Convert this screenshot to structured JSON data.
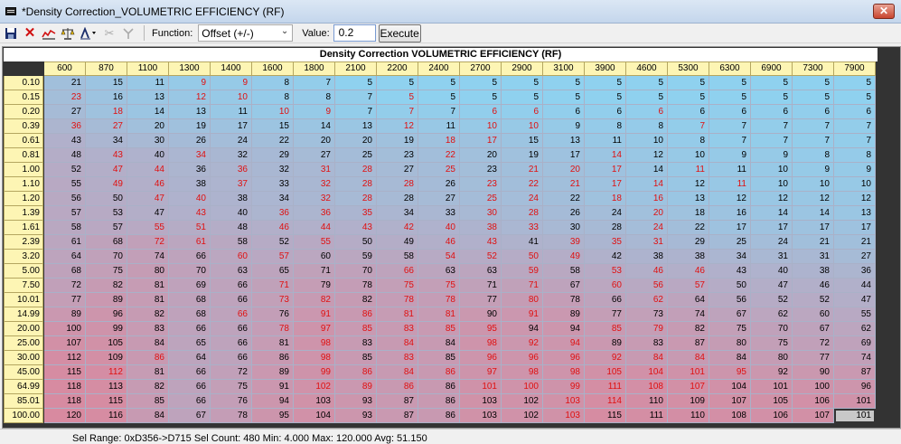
{
  "window": {
    "title": "*Density Correction_VOLUMETRIC EFFICIENCY (RF)",
    "close_label": "✕"
  },
  "toolbar": {
    "function_label": "Function:",
    "function_value": "Offset (+/-)",
    "value_label": "Value:",
    "value": "0.2",
    "execute_label": "Execute"
  },
  "table": {
    "title": "Density Correction  VOLUMETRIC EFFICIENCY (RF)",
    "columns": [
      "600",
      "870",
      "1100",
      "1300",
      "1400",
      "1600",
      "1800",
      "2100",
      "2200",
      "2400",
      "2700",
      "2900",
      "3100",
      "3900",
      "4600",
      "5300",
      "6300",
      "6900",
      "7300",
      "7900"
    ],
    "rows": [
      "0.10",
      "0.15",
      "0.20",
      "0.39",
      "0.61",
      "0.81",
      "1.00",
      "1.10",
      "1.20",
      "1.39",
      "1.61",
      "2.39",
      "3.20",
      "5.00",
      "7.50",
      "10.01",
      "14.99",
      "20.00",
      "25.00",
      "30.00",
      "45.00",
      "64.99",
      "85.01",
      "100.00"
    ],
    "values": [
      [
        21,
        15,
        11,
        9,
        9,
        8,
        7,
        5,
        5,
        5,
        5,
        5,
        5,
        5,
        5,
        5,
        5,
        5,
        5,
        5
      ],
      [
        23,
        16,
        13,
        12,
        10,
        8,
        8,
        7,
        5,
        5,
        5,
        5,
        5,
        5,
        5,
        5,
        5,
        5,
        5,
        5
      ],
      [
        27,
        18,
        14,
        13,
        11,
        10,
        9,
        7,
        7,
        7,
        6,
        6,
        6,
        6,
        6,
        6,
        6,
        6,
        6,
        6
      ],
      [
        36,
        27,
        20,
        19,
        17,
        15,
        14,
        13,
        12,
        11,
        10,
        10,
        9,
        8,
        8,
        7,
        7,
        7,
        7,
        7
      ],
      [
        43,
        34,
        30,
        26,
        24,
        22,
        20,
        20,
        19,
        18,
        17,
        15,
        13,
        11,
        10,
        8,
        7,
        7,
        7,
        7
      ],
      [
        48,
        43,
        40,
        34,
        32,
        29,
        27,
        25,
        23,
        22,
        20,
        19,
        17,
        14,
        12,
        10,
        9,
        9,
        8,
        8
      ],
      [
        52,
        47,
        44,
        36,
        36,
        32,
        31,
        28,
        27,
        25,
        23,
        21,
        20,
        17,
        14,
        11,
        11,
        10,
        9,
        9
      ],
      [
        55,
        49,
        46,
        38,
        37,
        33,
        32,
        28,
        28,
        26,
        23,
        22,
        21,
        17,
        14,
        12,
        11,
        10,
        10,
        10
      ],
      [
        56,
        50,
        47,
        40,
        38,
        34,
        32,
        28,
        28,
        27,
        25,
        24,
        22,
        18,
        16,
        13,
        12,
        12,
        12,
        12
      ],
      [
        57,
        53,
        47,
        43,
        40,
        36,
        36,
        35,
        34,
        33,
        30,
        28,
        26,
        24,
        20,
        18,
        16,
        14,
        14,
        13
      ],
      [
        58,
        57,
        55,
        51,
        48,
        46,
        44,
        43,
        42,
        40,
        38,
        33,
        30,
        28,
        24,
        22,
        17,
        17,
        17,
        17
      ],
      [
        61,
        68,
        72,
        61,
        58,
        52,
        55,
        50,
        49,
        46,
        43,
        41,
        39,
        35,
        31,
        29,
        25,
        24,
        21,
        21
      ],
      [
        64,
        70,
        74,
        66,
        60,
        57,
        60,
        59,
        58,
        54,
        52,
        50,
        49,
        42,
        38,
        38,
        34,
        31,
        31,
        27
      ],
      [
        68,
        75,
        80,
        70,
        63,
        65,
        71,
        70,
        66,
        63,
        63,
        59,
        58,
        53,
        46,
        46,
        43,
        40,
        38,
        36
      ],
      [
        72,
        82,
        81,
        69,
        66,
        71,
        79,
        78,
        75,
        75,
        71,
        71,
        67,
        60,
        56,
        57,
        50,
        47,
        46,
        44
      ],
      [
        77,
        89,
        81,
        68,
        66,
        73,
        82,
        82,
        78,
        78,
        77,
        80,
        78,
        66,
        62,
        64,
        56,
        52,
        52,
        47
      ],
      [
        89,
        96,
        82,
        68,
        66,
        76,
        91,
        86,
        81,
        81,
        90,
        91,
        89,
        77,
        73,
        74,
        67,
        62,
        60,
        55
      ],
      [
        100,
        99,
        83,
        66,
        66,
        78,
        97,
        85,
        83,
        85,
        95,
        94,
        94,
        85,
        79,
        82,
        75,
        70,
        67,
        62
      ],
      [
        107,
        105,
        84,
        65,
        66,
        81,
        98,
        83,
        84,
        84,
        98,
        92,
        94,
        89,
        83,
        87,
        80,
        75,
        72,
        69
      ],
      [
        112,
        109,
        86,
        64,
        66,
        86,
        98,
        85,
        83,
        85,
        96,
        96,
        96,
        92,
        84,
        84,
        84,
        80,
        77,
        74
      ],
      [
        115,
        112,
        81,
        66,
        72,
        89,
        99,
        86,
        84,
        86,
        97,
        98,
        98,
        105,
        104,
        101,
        95,
        92,
        90,
        87
      ],
      [
        118,
        113,
        82,
        66,
        75,
        91,
        102,
        89,
        86,
        86,
        101,
        100,
        99,
        111,
        108,
        107,
        104,
        101,
        100,
        96
      ],
      [
        118,
        115,
        85,
        66,
        76,
        94,
        103,
        93,
        87,
        86,
        103,
        102,
        103,
        114,
        110,
        109,
        107,
        105,
        106,
        101
      ],
      [
        120,
        116,
        84,
        67,
        78,
        95,
        104,
        93,
        87,
        86,
        103,
        102,
        103,
        115,
        111,
        110,
        108,
        106,
        107,
        101
      ]
    ],
    "red_cells": [
      [
        0,
        3
      ],
      [
        0,
        4
      ],
      [
        1,
        0
      ],
      [
        1,
        3
      ],
      [
        1,
        4
      ],
      [
        1,
        8
      ],
      [
        2,
        1
      ],
      [
        2,
        5
      ],
      [
        2,
        6
      ],
      [
        2,
        8
      ],
      [
        2,
        10
      ],
      [
        2,
        11
      ],
      [
        2,
        14
      ],
      [
        3,
        0
      ],
      [
        3,
        1
      ],
      [
        3,
        8
      ],
      [
        3,
        10
      ],
      [
        3,
        11
      ],
      [
        3,
        15
      ],
      [
        4,
        9
      ],
      [
        4,
        10
      ],
      [
        5,
        1
      ],
      [
        5,
        3
      ],
      [
        5,
        9
      ],
      [
        5,
        13
      ],
      [
        6,
        1
      ],
      [
        6,
        2
      ],
      [
        6,
        4
      ],
      [
        6,
        6
      ],
      [
        6,
        7
      ],
      [
        6,
        9
      ],
      [
        6,
        11
      ],
      [
        6,
        12
      ],
      [
        6,
        13
      ],
      [
        6,
        15
      ],
      [
        7,
        1
      ],
      [
        7,
        2
      ],
      [
        7,
        4
      ],
      [
        7,
        6
      ],
      [
        7,
        7
      ],
      [
        7,
        8
      ],
      [
        7,
        10
      ],
      [
        7,
        11
      ],
      [
        7,
        12
      ],
      [
        7,
        13
      ],
      [
        7,
        14
      ],
      [
        7,
        16
      ],
      [
        8,
        2
      ],
      [
        8,
        3
      ],
      [
        8,
        6
      ],
      [
        8,
        7
      ],
      [
        8,
        10
      ],
      [
        8,
        11
      ],
      [
        8,
        13
      ],
      [
        8,
        14
      ],
      [
        9,
        3
      ],
      [
        9,
        5
      ],
      [
        9,
        6
      ],
      [
        9,
        7
      ],
      [
        9,
        10
      ],
      [
        9,
        11
      ],
      [
        9,
        14
      ],
      [
        10,
        2
      ],
      [
        10,
        3
      ],
      [
        10,
        5
      ],
      [
        10,
        6
      ],
      [
        10,
        7
      ],
      [
        10,
        8
      ],
      [
        10,
        9
      ],
      [
        10,
        10
      ],
      [
        10,
        11
      ],
      [
        10,
        14
      ],
      [
        11,
        2
      ],
      [
        11,
        3
      ],
      [
        11,
        6
      ],
      [
        11,
        9
      ],
      [
        11,
        10
      ],
      [
        11,
        12
      ],
      [
        11,
        13
      ],
      [
        11,
        14
      ],
      [
        12,
        4
      ],
      [
        12,
        5
      ],
      [
        12,
        9
      ],
      [
        12,
        10
      ],
      [
        12,
        11
      ],
      [
        12,
        12
      ],
      [
        13,
        8
      ],
      [
        13,
        11
      ],
      [
        13,
        13
      ],
      [
        13,
        14
      ],
      [
        13,
        15
      ],
      [
        14,
        5
      ],
      [
        14,
        8
      ],
      [
        14,
        9
      ],
      [
        14,
        11
      ],
      [
        14,
        13
      ],
      [
        14,
        14
      ],
      [
        14,
        15
      ],
      [
        15,
        5
      ],
      [
        15,
        6
      ],
      [
        15,
        8
      ],
      [
        15,
        9
      ],
      [
        15,
        11
      ],
      [
        15,
        14
      ],
      [
        16,
        4
      ],
      [
        16,
        6
      ],
      [
        16,
        7
      ],
      [
        16,
        8
      ],
      [
        16,
        9
      ],
      [
        16,
        11
      ],
      [
        17,
        5
      ],
      [
        17,
        6
      ],
      [
        17,
        7
      ],
      [
        17,
        8
      ],
      [
        17,
        9
      ],
      [
        17,
        10
      ],
      [
        17,
        13
      ],
      [
        17,
        14
      ],
      [
        18,
        6
      ],
      [
        18,
        8
      ],
      [
        18,
        10
      ],
      [
        18,
        11
      ],
      [
        18,
        12
      ],
      [
        19,
        2
      ],
      [
        19,
        6
      ],
      [
        19,
        8
      ],
      [
        19,
        10
      ],
      [
        19,
        11
      ],
      [
        19,
        12
      ],
      [
        19,
        13
      ],
      [
        19,
        14
      ],
      [
        19,
        15
      ],
      [
        20,
        1
      ],
      [
        20,
        6
      ],
      [
        20,
        7
      ],
      [
        20,
        8
      ],
      [
        20,
        9
      ],
      [
        20,
        10
      ],
      [
        20,
        11
      ],
      [
        20,
        12
      ],
      [
        20,
        13
      ],
      [
        20,
        14
      ],
      [
        20,
        15
      ],
      [
        20,
        16
      ],
      [
        21,
        6
      ],
      [
        21,
        7
      ],
      [
        21,
        8
      ],
      [
        21,
        10
      ],
      [
        21,
        11
      ],
      [
        21,
        12
      ],
      [
        21,
        13
      ],
      [
        21,
        14
      ],
      [
        21,
        15
      ],
      [
        22,
        12
      ],
      [
        22,
        13
      ],
      [
        23,
        12
      ]
    ]
  },
  "status": {
    "text": "Sel Range: 0xD356->D715  Sel Count: 480  Min: 4.000  Max: 120.000  Avg: 51.150"
  },
  "colors": {
    "header_bg": "#fdf5b4",
    "low": "#8fd1ef",
    "high": "#d88aa0",
    "red_text": "#e01010"
  }
}
